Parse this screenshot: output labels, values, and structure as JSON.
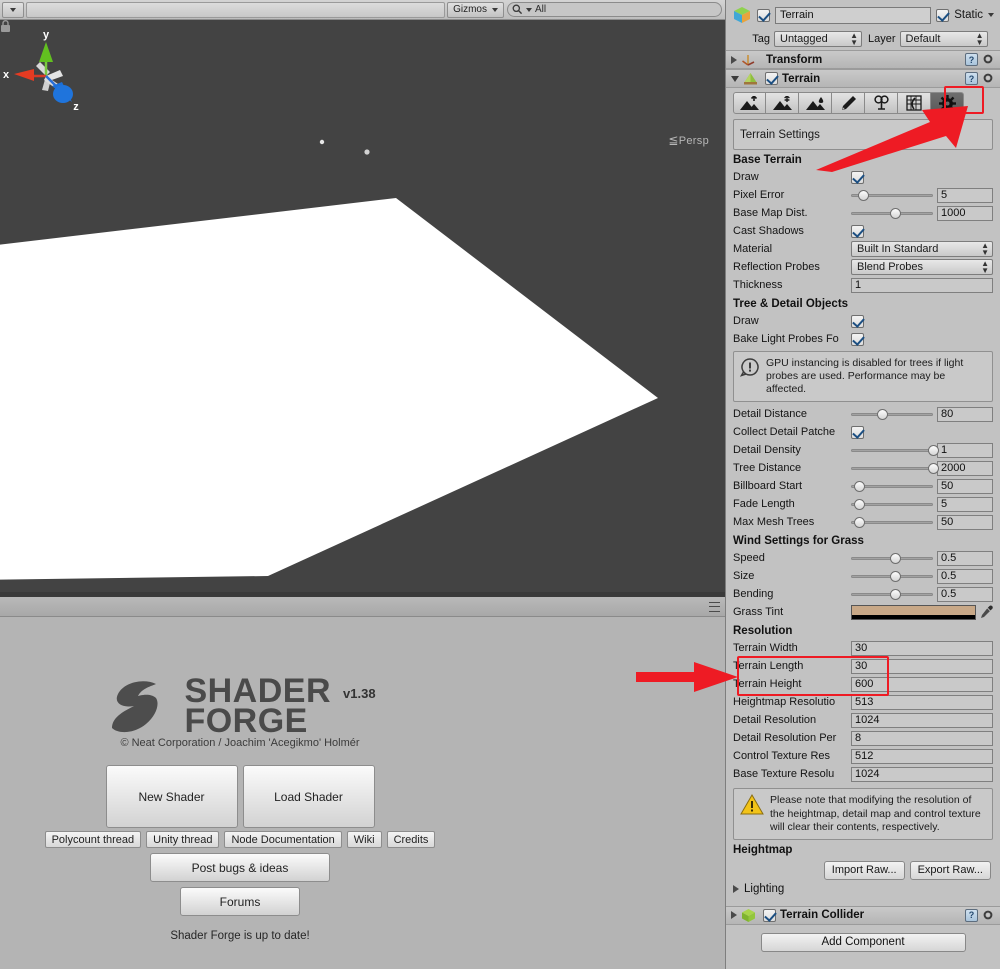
{
  "scene_toolbar": {
    "gizmos_label": "Gizmos",
    "search_value": "All",
    "search_icon": "search-icon"
  },
  "scene_view": {
    "gizmo": {
      "x": "x",
      "y": "y",
      "z": "z",
      "projection": "Persp"
    },
    "lock_icon": "lock-icon"
  },
  "shader_forge": {
    "logo_line1": "SHADER",
    "logo_line2": "FORGE",
    "version": "v1.38",
    "credit": "© Neat Corporation / Joachim 'Acegikmo' Holmér",
    "primary_buttons": [
      "New Shader",
      "Load Shader"
    ],
    "link_buttons": [
      "Polycount thread",
      "Unity thread",
      "Node Documentation",
      "Wiki",
      "Credits"
    ],
    "bugs_button": "Post bugs & ideas",
    "forums_button": "Forums",
    "status": "Shader Forge is up to date!"
  },
  "inspector": {
    "gameobject": {
      "active": true,
      "name": "Terrain",
      "static_label": "Static",
      "tag_label": "Tag",
      "tag_value": "Untagged",
      "layer_label": "Layer",
      "layer_value": "Default"
    },
    "components": [
      {
        "title": "Transform",
        "expanded": false
      },
      {
        "title": "Terrain",
        "expanded": true,
        "enabled": true
      },
      {
        "title": "Terrain Collider",
        "expanded": false,
        "enabled": true
      }
    ],
    "terrain_tools": [
      "raise-lower-terrain-tool",
      "set-height-tool",
      "smooth-height-tool",
      "paint-texture-tool",
      "place-trees-tool",
      "paint-details-tool",
      "terrain-settings-tool"
    ],
    "terrain_tool_selected_index": 6,
    "settings_header": "Terrain Settings",
    "sections": [
      {
        "title": "Base Terrain",
        "rows": [
          {
            "label": "Draw",
            "type": "checkbox",
            "value": true
          },
          {
            "label": "Pixel Error",
            "type": "slider",
            "value": "5",
            "pos": 8
          },
          {
            "label": "Base Map Dist.",
            "type": "slider",
            "value": "1000",
            "pos": 48
          },
          {
            "label": "Cast Shadows",
            "type": "checkbox",
            "value": true
          },
          {
            "label": "Material",
            "type": "dropdown",
            "value": "Built In Standard"
          },
          {
            "label": "Reflection Probes",
            "type": "dropdown",
            "value": "Blend Probes"
          },
          {
            "label": "Thickness",
            "type": "field",
            "value": "1"
          }
        ]
      },
      {
        "title": "Tree & Detail Objects",
        "rows": [
          {
            "label": "Draw",
            "type": "checkbox",
            "value": true
          },
          {
            "label": "Bake Light Probes Fo",
            "type": "checkbox",
            "value": true
          },
          {
            "label": "",
            "type": "infobox",
            "icon": "info-icon",
            "value": "GPU instancing is disabled for trees if light probes are used. Performance may be affected."
          },
          {
            "label": "Detail Distance",
            "type": "slider",
            "value": "80",
            "pos": 32
          },
          {
            "label": "Collect Detail Patche",
            "type": "checkbox",
            "value": true
          },
          {
            "label": "Detail Density",
            "type": "slider",
            "value": "1",
            "pos": 94
          },
          {
            "label": "Tree Distance",
            "type": "slider",
            "value": "2000",
            "pos": 94
          },
          {
            "label": "Billboard Start",
            "type": "slider",
            "value": "50",
            "pos": 5
          },
          {
            "label": "Fade Length",
            "type": "slider",
            "value": "5",
            "pos": 5
          },
          {
            "label": "Max Mesh Trees",
            "type": "slider",
            "value": "50",
            "pos": 5
          }
        ]
      },
      {
        "title": "Wind Settings for Grass",
        "rows": [
          {
            "label": "Speed",
            "type": "slider",
            "value": "0.5",
            "pos": 48
          },
          {
            "label": "Size",
            "type": "slider",
            "value": "0.5",
            "pos": 48
          },
          {
            "label": "Bending",
            "type": "slider",
            "value": "0.5",
            "pos": 48
          },
          {
            "label": "Grass Tint",
            "type": "color",
            "value": "#c8a887",
            "picker_icon": "eyedropper-icon"
          }
        ]
      },
      {
        "title": "Resolution",
        "rows": [
          {
            "label": "Terrain Width",
            "type": "field",
            "value": "30",
            "highlighted": true
          },
          {
            "label": "Terrain Length",
            "type": "field",
            "value": "30",
            "highlighted": true
          },
          {
            "label": "Terrain Height",
            "type": "field",
            "value": "600"
          },
          {
            "label": "Heightmap Resolutio",
            "type": "field",
            "value": "513"
          },
          {
            "label": "Detail Resolution",
            "type": "field",
            "value": "1024"
          },
          {
            "label": "Detail Resolution Per",
            "type": "field",
            "value": "8"
          },
          {
            "label": "Control Texture Res",
            "type": "field",
            "value": "512"
          },
          {
            "label": "Base Texture Resolu",
            "type": "field",
            "value": "1024"
          },
          {
            "label": "",
            "type": "warnbox",
            "icon": "warning-icon",
            "value": "Please note that modifying the resolution of the heightmap, detail map and control texture will clear their contents, respectively."
          }
        ]
      },
      {
        "title": "Heightmap",
        "rows": [
          {
            "label": "",
            "type": "buttons",
            "buttons": [
              "Import Raw...",
              "Export Raw..."
            ]
          }
        ]
      }
    ],
    "lighting_foldout": "Lighting",
    "add_component": "Add Component"
  },
  "annotations": {
    "arrow_to_settings_tool": "red-arrow",
    "arrow_to_terrain_size": "red-arrow",
    "highlight_color": "#ee1b24"
  }
}
